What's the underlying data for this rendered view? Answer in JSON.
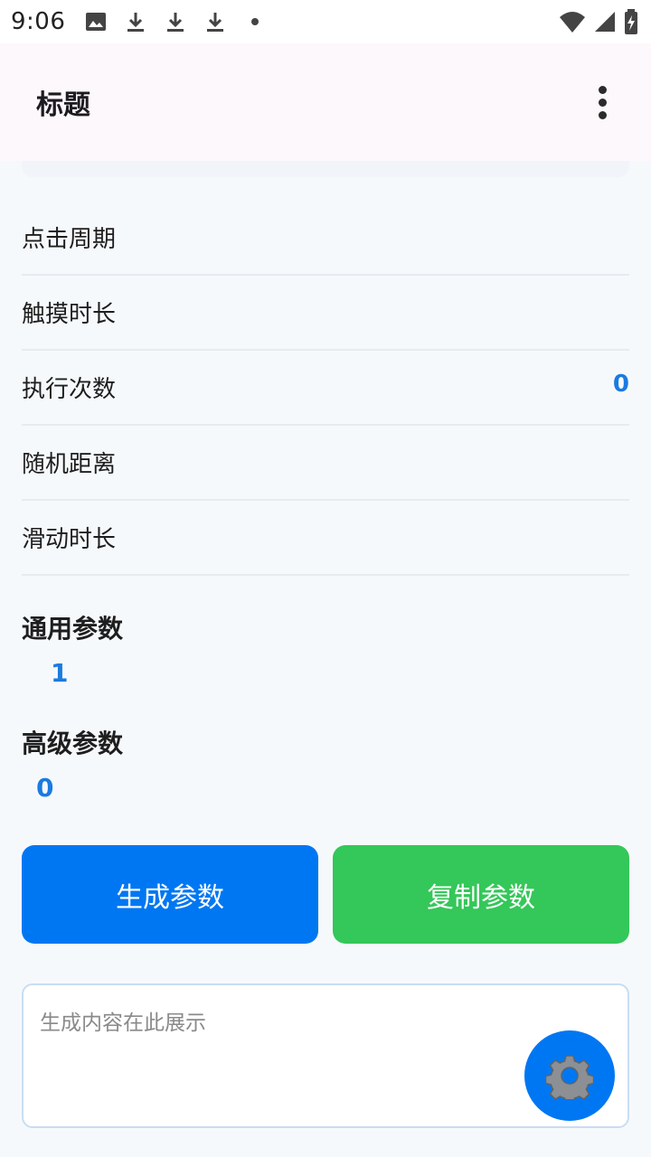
{
  "status_bar": {
    "time": "9:06",
    "left_icons": [
      "image-icon",
      "download-icon",
      "download-icon",
      "download-icon",
      "dot-icon"
    ],
    "right_icons": [
      "wifi-icon",
      "signal-icon",
      "battery-charging-icon"
    ]
  },
  "app_bar": {
    "title": "标题",
    "menu_icon": "more-vert-icon"
  },
  "settings": {
    "rows": [
      {
        "label": "点击周期",
        "value": ""
      },
      {
        "label": "触摸时长",
        "value": ""
      },
      {
        "label": "执行次数",
        "value": "0"
      },
      {
        "label": "随机距离",
        "value": ""
      },
      {
        "label": "滑动时长",
        "value": ""
      }
    ]
  },
  "general_params": {
    "title": "通用参数",
    "value": "1"
  },
  "advanced_params": {
    "title": "高级参数",
    "value": "0"
  },
  "actions": {
    "generate_label": "生成参数",
    "copy_label": "复制参数"
  },
  "output": {
    "placeholder": "生成内容在此展示"
  },
  "fab": {
    "icon": "gear-icon"
  },
  "colors": {
    "primary_blue": "#0077f2",
    "value_blue": "#1a7be0",
    "green": "#34c759",
    "background": "#f6f9fc",
    "app_bar": "#fdf8fc"
  }
}
